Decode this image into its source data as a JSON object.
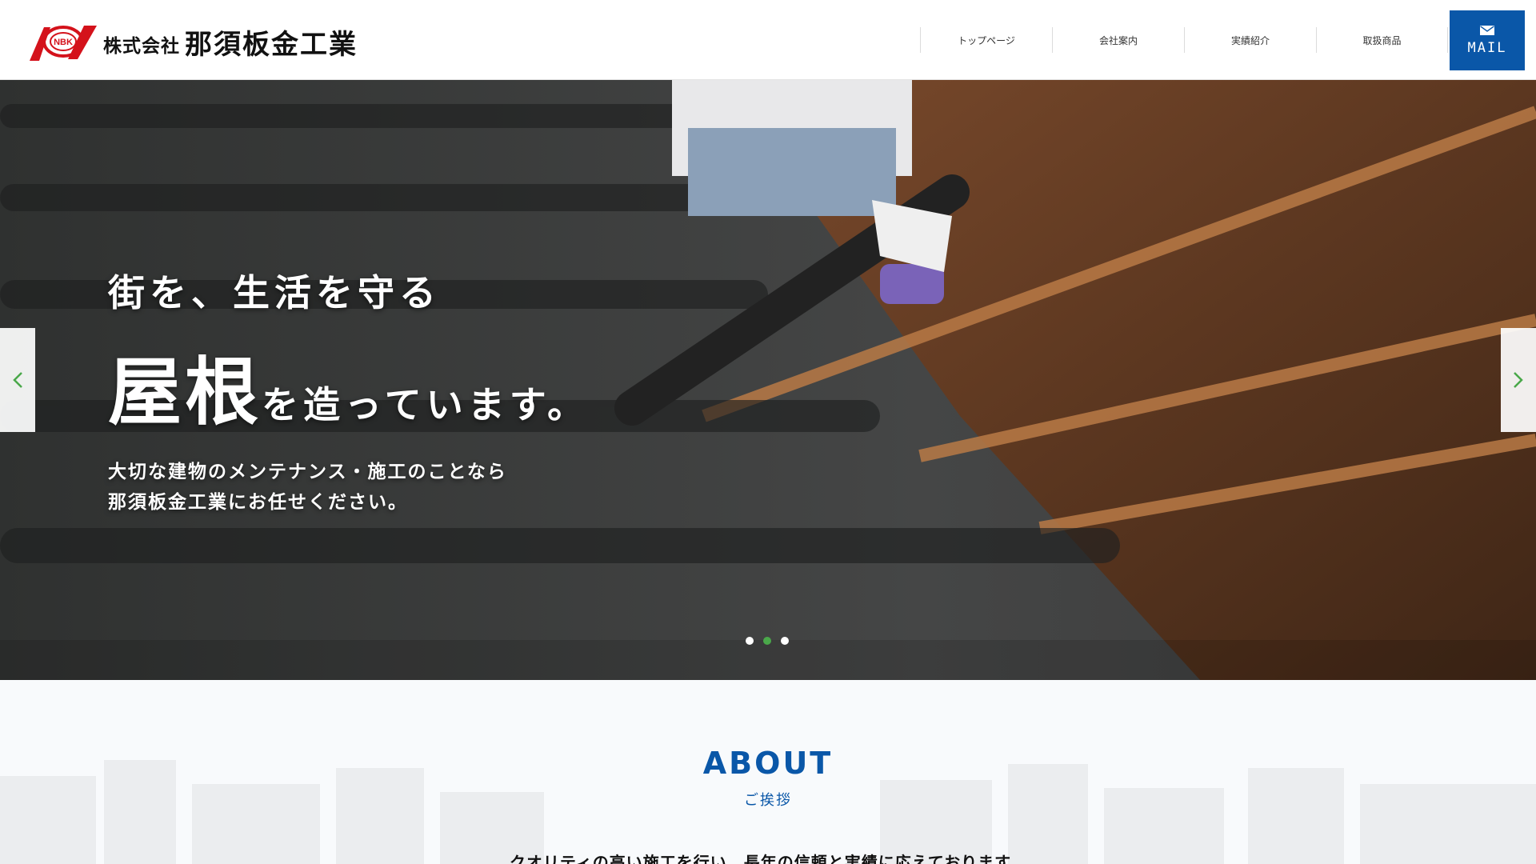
{
  "header": {
    "logo_emblem": "NBK",
    "logo_small": "株式会社",
    "logo_main": "那須板金工業",
    "nav": [
      {
        "label": "トップページ"
      },
      {
        "label": "会社案内"
      },
      {
        "label": "実績紹介"
      },
      {
        "label": "取扱商品"
      }
    ],
    "mail_label": "MAIL",
    "mail_icon": "envelope-icon"
  },
  "hero": {
    "line1": "街を、生活を守る",
    "line2_big": "屋根",
    "line2_rest": "を造っています。",
    "sub1": "大切な建物のメンテナンス・施工のことなら",
    "sub2": "那須板金工業にお任せください。",
    "prev_icon": "chevron-left-icon",
    "next_icon": "chevron-right-icon",
    "active_slide": 2,
    "slide_count": 3
  },
  "about": {
    "title": "ABOUT",
    "subtitle": "ご挨拶",
    "text": "クオリティの高い施工を行い、長年の信頼と実績に応えております。"
  },
  "colors": {
    "brand_blue": "#0a57a8",
    "logo_red": "#d4121b",
    "dot_active": "#4aa84a"
  }
}
